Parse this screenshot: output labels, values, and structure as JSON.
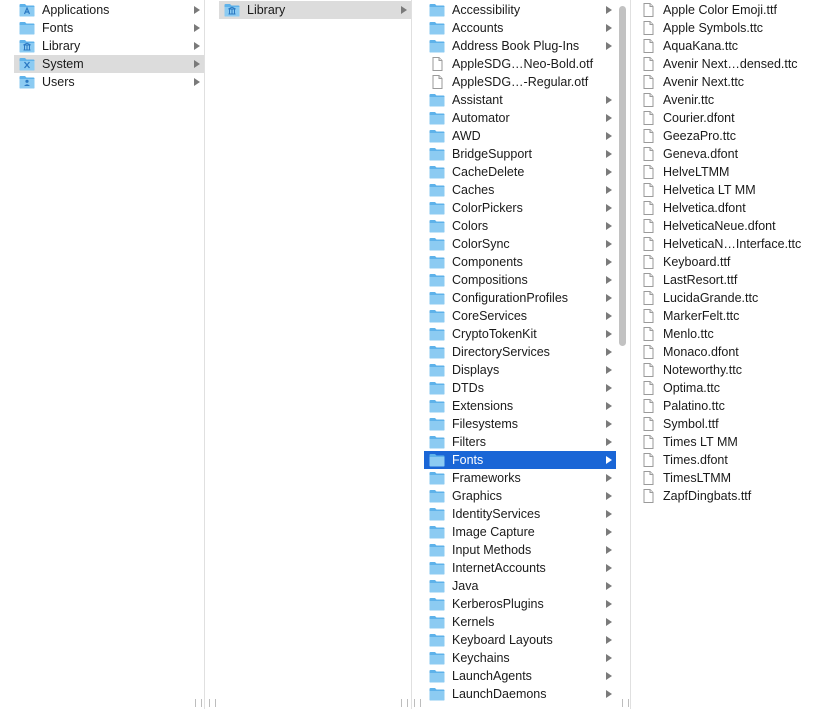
{
  "columns": {
    "sidebar": {
      "items": [
        {
          "label": "Applications",
          "icon": "applications-folder-icon",
          "has_arrow": true,
          "selected": ""
        },
        {
          "label": "Fonts",
          "icon": "folder-icon",
          "has_arrow": true,
          "selected": ""
        },
        {
          "label": "Library",
          "icon": "library-folder-icon",
          "has_arrow": true,
          "selected": ""
        },
        {
          "label": "System",
          "icon": "system-folder-icon",
          "has_arrow": true,
          "selected": "gray"
        },
        {
          "label": "Users",
          "icon": "users-folder-icon",
          "has_arrow": true,
          "selected": ""
        }
      ]
    },
    "system": {
      "items": [
        {
          "label": "Library",
          "icon": "library-folder-icon",
          "has_arrow": true,
          "selected": "gray"
        }
      ]
    },
    "library": {
      "items": [
        {
          "label": "Accessibility",
          "icon": "folder-icon",
          "has_arrow": true
        },
        {
          "label": "Accounts",
          "icon": "folder-icon",
          "has_arrow": true
        },
        {
          "label": "Address Book Plug-Ins",
          "icon": "folder-icon",
          "has_arrow": true
        },
        {
          "label": "AppleSDG…Neo-Bold.otf",
          "icon": "file-icon",
          "has_arrow": false
        },
        {
          "label": "AppleSDG…-Regular.otf",
          "icon": "file-icon",
          "has_arrow": false
        },
        {
          "label": "Assistant",
          "icon": "folder-icon",
          "has_arrow": true
        },
        {
          "label": "Automator",
          "icon": "folder-icon",
          "has_arrow": true
        },
        {
          "label": "AWD",
          "icon": "folder-icon",
          "has_arrow": true
        },
        {
          "label": "BridgeSupport",
          "icon": "folder-icon",
          "has_arrow": true
        },
        {
          "label": "CacheDelete",
          "icon": "folder-icon",
          "has_arrow": true
        },
        {
          "label": "Caches",
          "icon": "folder-icon",
          "has_arrow": true
        },
        {
          "label": "ColorPickers",
          "icon": "folder-icon",
          "has_arrow": true
        },
        {
          "label": "Colors",
          "icon": "folder-icon",
          "has_arrow": true
        },
        {
          "label": "ColorSync",
          "icon": "folder-icon",
          "has_arrow": true
        },
        {
          "label": "Components",
          "icon": "folder-icon",
          "has_arrow": true
        },
        {
          "label": "Compositions",
          "icon": "folder-icon",
          "has_arrow": true
        },
        {
          "label": "ConfigurationProfiles",
          "icon": "folder-icon",
          "has_arrow": true
        },
        {
          "label": "CoreServices",
          "icon": "folder-icon",
          "has_arrow": true
        },
        {
          "label": "CryptoTokenKit",
          "icon": "folder-icon",
          "has_arrow": true
        },
        {
          "label": "DirectoryServices",
          "icon": "folder-icon",
          "has_arrow": true
        },
        {
          "label": "Displays",
          "icon": "folder-icon",
          "has_arrow": true
        },
        {
          "label": "DTDs",
          "icon": "folder-icon",
          "has_arrow": true
        },
        {
          "label": "Extensions",
          "icon": "folder-icon",
          "has_arrow": true
        },
        {
          "label": "Filesystems",
          "icon": "folder-icon",
          "has_arrow": true
        },
        {
          "label": "Filters",
          "icon": "folder-icon",
          "has_arrow": true
        },
        {
          "label": "Fonts",
          "icon": "folder-icon",
          "has_arrow": true,
          "selected": "blue"
        },
        {
          "label": "Frameworks",
          "icon": "folder-icon",
          "has_arrow": true
        },
        {
          "label": "Graphics",
          "icon": "folder-icon",
          "has_arrow": true
        },
        {
          "label": "IdentityServices",
          "icon": "folder-icon",
          "has_arrow": true
        },
        {
          "label": "Image Capture",
          "icon": "folder-icon",
          "has_arrow": true
        },
        {
          "label": "Input Methods",
          "icon": "folder-icon",
          "has_arrow": true
        },
        {
          "label": "InternetAccounts",
          "icon": "folder-icon",
          "has_arrow": true
        },
        {
          "label": "Java",
          "icon": "folder-icon",
          "has_arrow": true
        },
        {
          "label": "KerberosPlugins",
          "icon": "folder-icon",
          "has_arrow": true
        },
        {
          "label": "Kernels",
          "icon": "folder-icon",
          "has_arrow": true
        },
        {
          "label": "Keyboard Layouts",
          "icon": "folder-icon",
          "has_arrow": true
        },
        {
          "label": "Keychains",
          "icon": "folder-icon",
          "has_arrow": true
        },
        {
          "label": "LaunchAgents",
          "icon": "folder-icon",
          "has_arrow": true
        },
        {
          "label": "LaunchDaemons",
          "icon": "folder-icon",
          "has_arrow": true
        }
      ]
    },
    "fonts": {
      "items": [
        {
          "label": "Apple Color Emoji.ttf",
          "icon": "file-icon"
        },
        {
          "label": "Apple Symbols.ttc",
          "icon": "file-icon"
        },
        {
          "label": "AquaKana.ttc",
          "icon": "file-icon"
        },
        {
          "label": "Avenir Next…densed.ttc",
          "icon": "file-icon"
        },
        {
          "label": "Avenir Next.ttc",
          "icon": "file-icon"
        },
        {
          "label": "Avenir.ttc",
          "icon": "file-icon"
        },
        {
          "label": "Courier.dfont",
          "icon": "file-icon"
        },
        {
          "label": "GeezaPro.ttc",
          "icon": "file-icon"
        },
        {
          "label": "Geneva.dfont",
          "icon": "file-icon"
        },
        {
          "label": "HelveLTMM",
          "icon": "file-icon"
        },
        {
          "label": "Helvetica LT MM",
          "icon": "file-icon"
        },
        {
          "label": "Helvetica.dfont",
          "icon": "file-icon"
        },
        {
          "label": "HelveticaNeue.dfont",
          "icon": "file-icon"
        },
        {
          "label": "HelveticaN…Interface.ttc",
          "icon": "file-icon"
        },
        {
          "label": "Keyboard.ttf",
          "icon": "file-icon"
        },
        {
          "label": "LastResort.ttf",
          "icon": "file-icon"
        },
        {
          "label": "LucidaGrande.ttc",
          "icon": "file-icon"
        },
        {
          "label": "MarkerFelt.ttc",
          "icon": "file-icon"
        },
        {
          "label": "Menlo.ttc",
          "icon": "file-icon"
        },
        {
          "label": "Monaco.dfont",
          "icon": "file-icon"
        },
        {
          "label": "Noteworthy.ttc",
          "icon": "file-icon"
        },
        {
          "label": "Optima.ttc",
          "icon": "file-icon"
        },
        {
          "label": "Palatino.ttc",
          "icon": "file-icon"
        },
        {
          "label": "Symbol.ttf",
          "icon": "file-icon"
        },
        {
          "label": "Times LT MM",
          "icon": "file-icon"
        },
        {
          "label": "Times.dfont",
          "icon": "file-icon"
        },
        {
          "label": "TimesLTMM",
          "icon": "file-icon"
        },
        {
          "label": "ZapfDingbats.ttf",
          "icon": "file-icon"
        }
      ]
    }
  },
  "colors": {
    "folder_light": "#8ccbf2",
    "folder_dark": "#5eb2ea",
    "selection_blue": "#1a66d6",
    "selection_gray": "#dcdcdc"
  }
}
